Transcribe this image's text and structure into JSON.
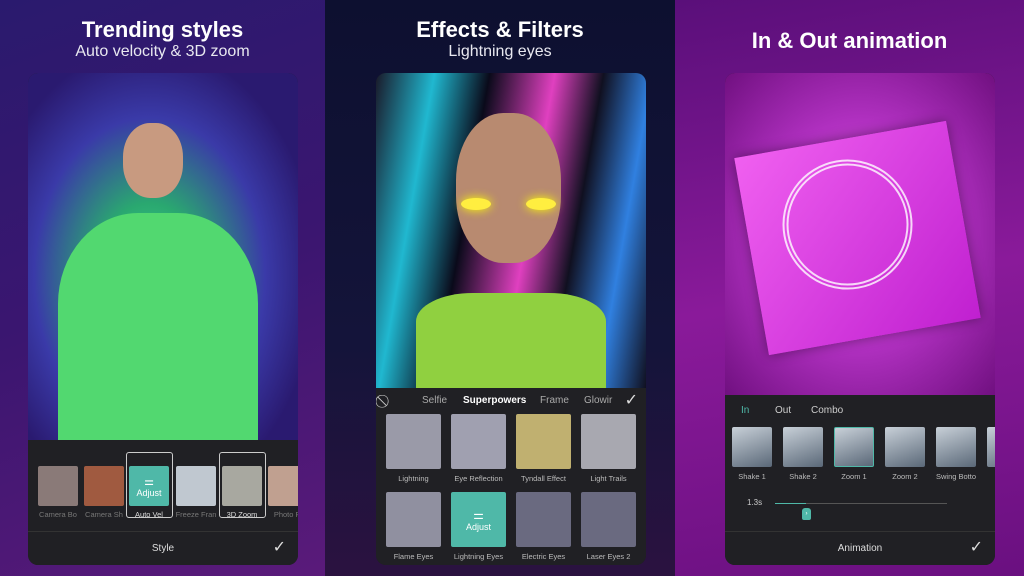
{
  "panel1": {
    "title": "Trending styles",
    "subtitle": "Auto velocity & 3D zoom",
    "items": [
      "Camera Bo",
      "Camera Sh",
      "Auto Vel",
      "Freeze Fran",
      "3D Zoom",
      "Photo Pl"
    ],
    "adjust_label": "Adjust",
    "footer": "Style"
  },
  "panel2": {
    "title": "Effects & Filters",
    "subtitle": "Lightning eyes",
    "tabs": [
      "Selfie",
      "Superpowers",
      "Frame",
      "Glowir"
    ],
    "active_tab": "Superpowers",
    "items": [
      "Lightning",
      "Eye Reflection",
      "Tyndall Effect",
      "Light Trails",
      "Flame Eyes",
      "Lightning Eyes",
      "Electric Eyes",
      "Laser Eyes 2"
    ],
    "adjust_label": "Adjust"
  },
  "panel3": {
    "title": "In & Out animation",
    "tabs": [
      "In",
      "Out",
      "Combo"
    ],
    "active_tab": "In",
    "items": [
      "Shake 1",
      "Shake 2",
      "Zoom 1",
      "Zoom 2",
      "Swing Botto",
      "Swi"
    ],
    "duration": "1.3s",
    "slider_fraction": 0.18,
    "footer": "Animation"
  },
  "colors": {
    "accent": "#4fb8a8"
  },
  "icons": {
    "confirm": "checkmark-icon",
    "none": "no-effect-icon",
    "adjust": "sliders-icon"
  }
}
